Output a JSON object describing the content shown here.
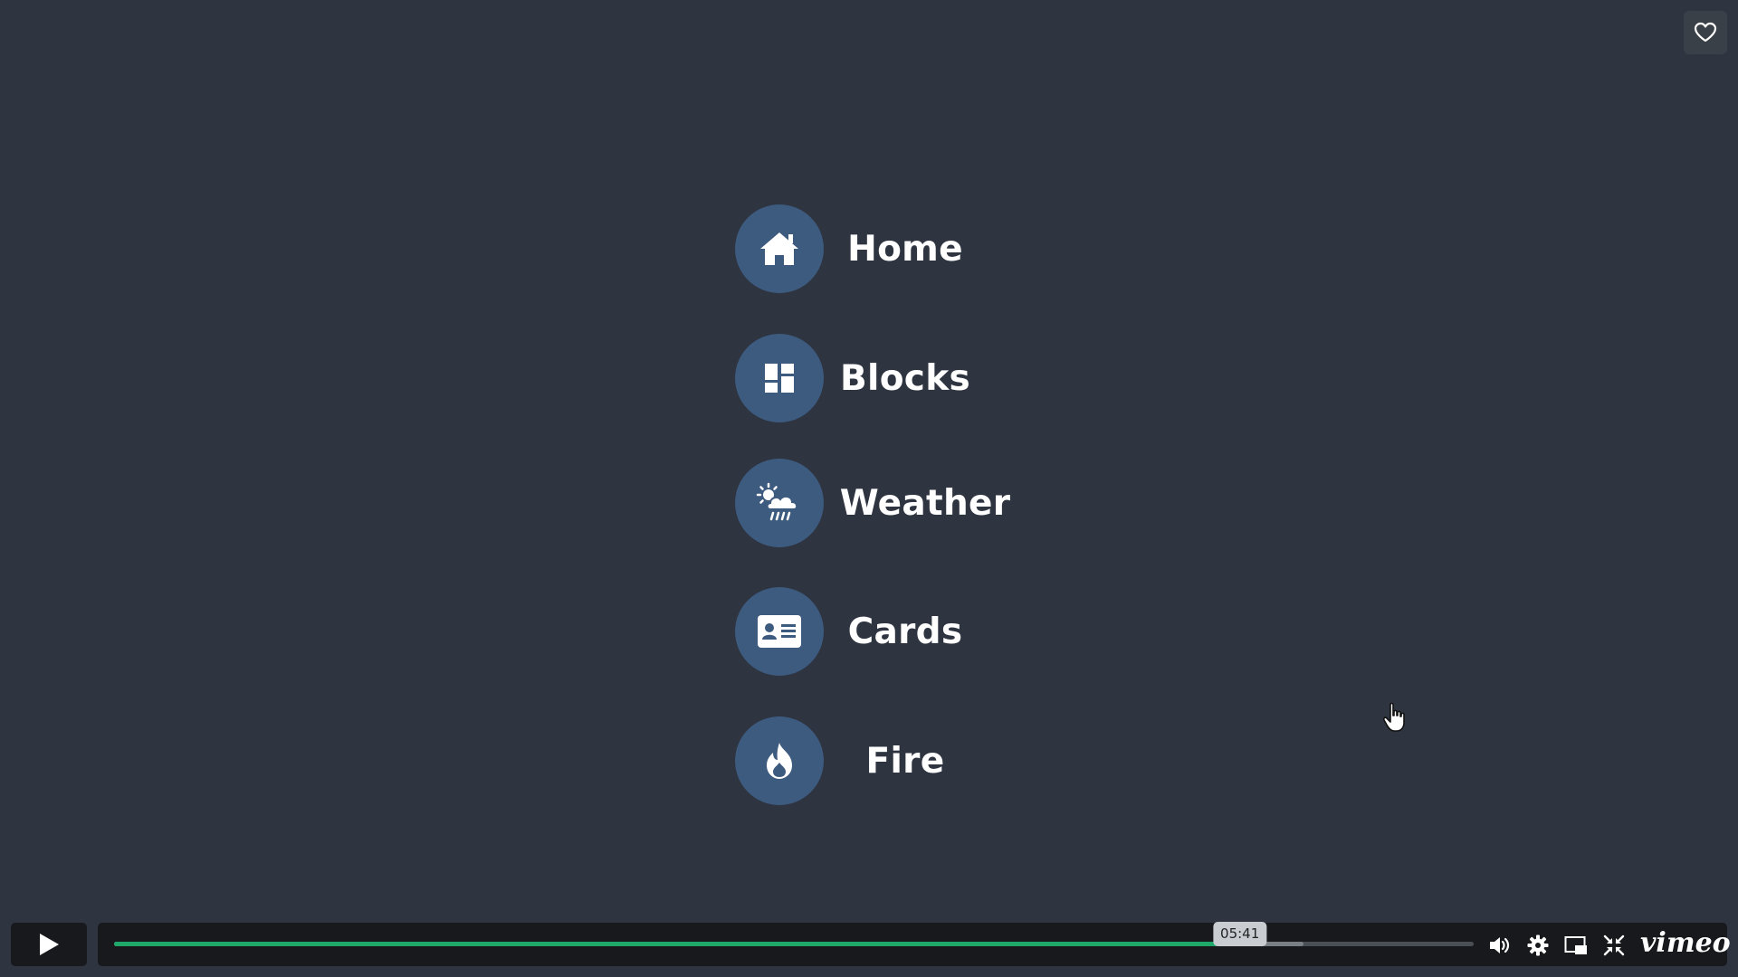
{
  "menu": {
    "items": [
      {
        "label": "Home",
        "icon": "home-icon"
      },
      {
        "label": "Blocks",
        "icon": "dashboard-blocks-icon"
      },
      {
        "label": "Weather",
        "icon": "sun-rain-cloud-icon"
      },
      {
        "label": "Cards",
        "icon": "id-card-icon"
      },
      {
        "label": "Fire",
        "icon": "flame-icon"
      }
    ]
  },
  "player": {
    "time_tooltip": "05:41",
    "played_fraction": 0.828,
    "buffered_fraction": 0.875,
    "brand": "vimeo"
  },
  "colors": {
    "background": "#2e3440",
    "icon_circle": "#3d5a7f",
    "progress_played": "#1fa86a",
    "control_bar": "#17191c"
  }
}
